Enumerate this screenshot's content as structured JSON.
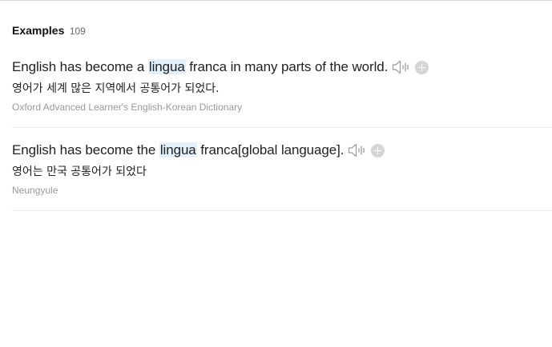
{
  "section": {
    "title": "Examples",
    "count": "109"
  },
  "examples": [
    {
      "before": "English has become a ",
      "highlight": "lingua",
      "after": " franca in many parts of the world.",
      "translation": "영어가 세계 많은 지역에서 공통어가 되었다.",
      "source": "Oxford Advanced Learner's English-Korean Dictionary"
    },
    {
      "before": "English has become the ",
      "highlight": "lingua",
      "after": " franca[global language].",
      "translation": "영어는 만국 공통어가 되었다",
      "source": "Neungyule"
    }
  ],
  "icons": {
    "speaker": "speaker-icon",
    "add": "plus-circle-icon"
  },
  "colors": {
    "highlight": "#e3f0fb",
    "source_text": "#999999",
    "icon": "#aaaaaa"
  }
}
